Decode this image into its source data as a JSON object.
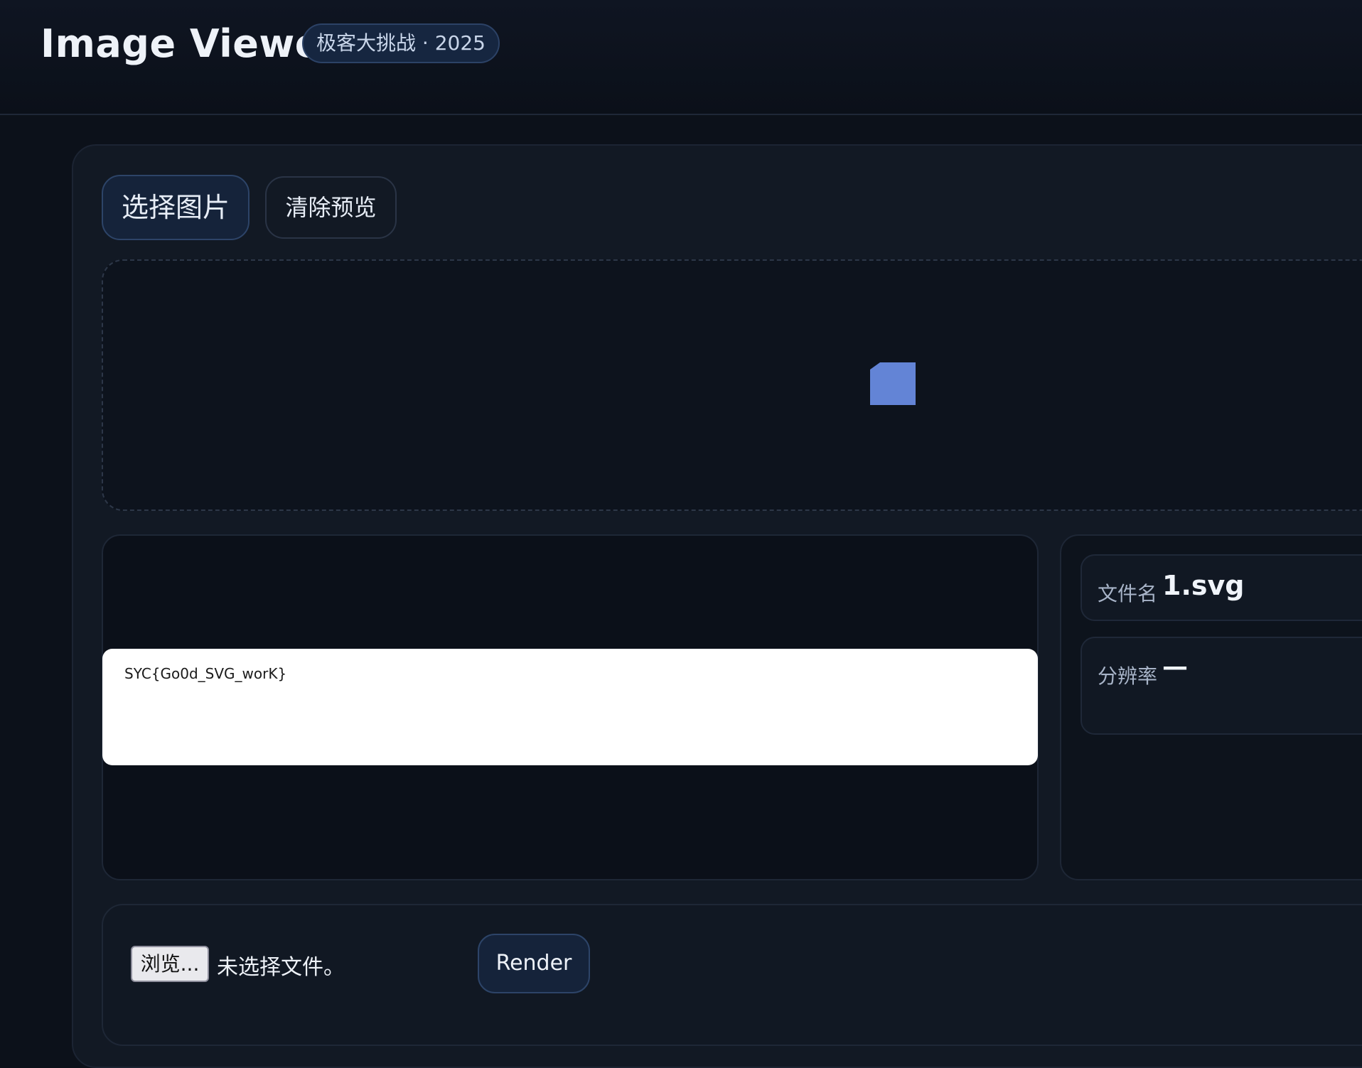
{
  "header": {
    "title": "Image Viewer",
    "badge": "极客大挑战 · 2025"
  },
  "toolbar": {
    "select_image_label": "选择图片",
    "clear_preview_label": "清除预览"
  },
  "preview": {
    "icon": "image-icon",
    "icon_color": "#6384d6"
  },
  "render": {
    "output_text": "SYC{Go0d_SVG_worK}"
  },
  "info": {
    "filename_label": "文件名",
    "filename_value": "1.svg",
    "resolution_label": "分辨率",
    "resolution_value": "—"
  },
  "upload": {
    "browse_label": "浏览...",
    "file_status": "未选择文件。",
    "render_label": "Render"
  },
  "colors": {
    "background": "#0c111a",
    "card": "#121924",
    "accent_border": "#2d4468",
    "accent_fill": "#15233a"
  }
}
